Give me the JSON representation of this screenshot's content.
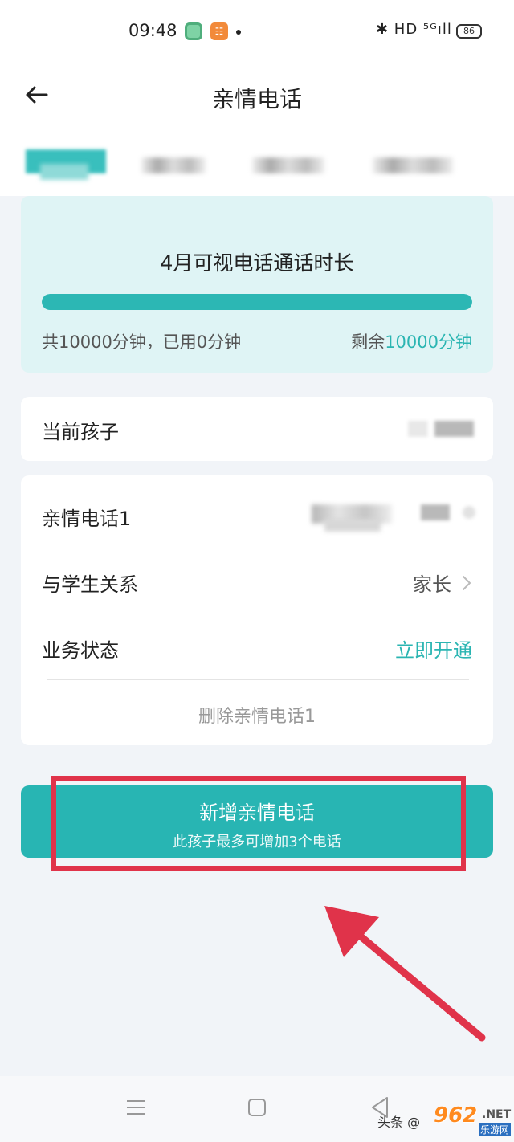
{
  "status_bar": {
    "time": "09:48",
    "right_indicators": "✱ HD ⁵ᴳıll",
    "battery": "86"
  },
  "header": {
    "title": "亲情电话"
  },
  "duration": {
    "title": "4月可视电话通话时长",
    "progress_remaining_fraction": 1.0,
    "total_text": "共10000分钟，已用0分钟",
    "remaining_prefix": "剩余",
    "remaining_value": "10000分钟",
    "accent_color": "#2ab5b2"
  },
  "child": {
    "label": "当前孩子"
  },
  "phone": {
    "label": "亲情电话1",
    "relation_label": "与学生关系",
    "relation_value": "家长",
    "status_label": "业务状态",
    "status_value": "立即开通",
    "delete_label": "删除亲情电话1"
  },
  "add_button": {
    "title": "新增亲情电话",
    "subtitle": "此孩子最多可增加3个电话",
    "color": "#28b5b3"
  },
  "watermark": {
    "prefix": "头条 @",
    "logo": "962",
    "suffix": ".NET",
    "cn": "乐游网"
  }
}
